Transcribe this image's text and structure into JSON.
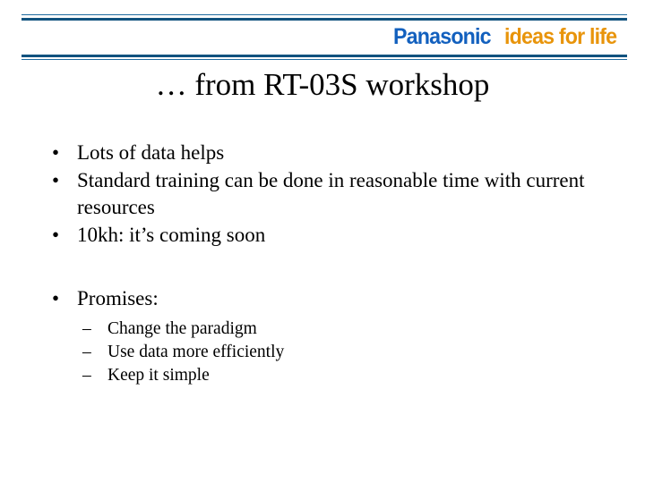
{
  "slide": {
    "title": "… from RT-03S workshop",
    "background_color": "#FFFFFF",
    "text_color": "#000000"
  },
  "header": {
    "rule_color_thin": "#1E6A9E",
    "rule_color_thick": "#11527E",
    "logo": {
      "brand": "Panasonic",
      "tagline": "ideas for life",
      "brand_color": "#1260BE",
      "tagline_color": "#E8940A"
    }
  },
  "body": {
    "bullet_marker": "•",
    "sub_bullet_marker": "–",
    "bullets": [
      {
        "level": 1,
        "text": "Lots of data helps"
      },
      {
        "level": 1,
        "text": "Standard training can be done in reasonable time with current resources"
      },
      {
        "level": 1,
        "text": "10kh: it’s coming soon"
      },
      {
        "level": 1,
        "text": "Promises:"
      },
      {
        "level": 2,
        "text": "Change the paradigm"
      },
      {
        "level": 2,
        "text": "Use data more efficiently"
      },
      {
        "level": 2,
        "text": "Keep it simple"
      }
    ]
  }
}
